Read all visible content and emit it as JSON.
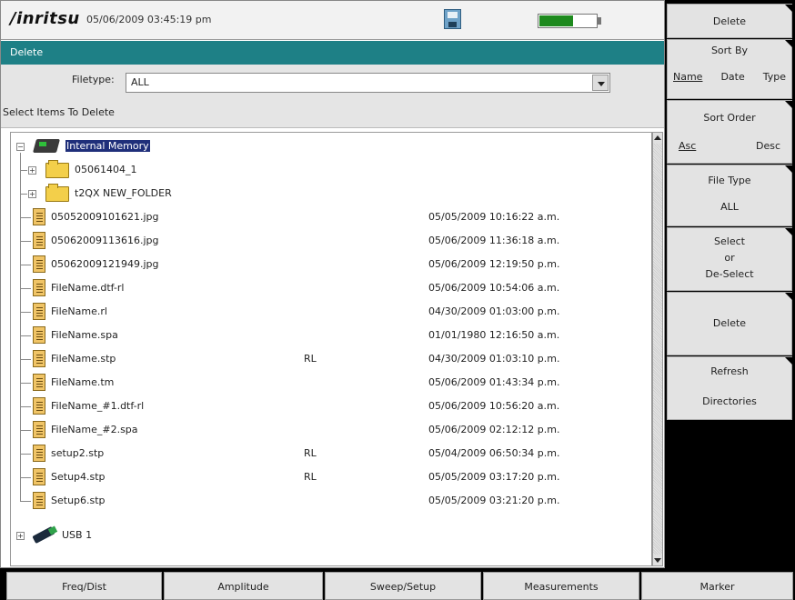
{
  "header": {
    "logo": "/inritsu",
    "datetime": "05/06/2009 03:45:19 pm",
    "battery_level": 0.6
  },
  "panel": {
    "title": "Delete",
    "filetype_label": "Filetype:",
    "filetype_value": "ALL",
    "select_items_label": "Select Items To Delete"
  },
  "tree": {
    "root": "Internal Memory",
    "folders": [
      "05061404_1",
      "t2QX NEW_FOLDER"
    ],
    "files": [
      {
        "name": "05052009101621.jpg",
        "type": "",
        "date": "05/05/2009 10:16:22 a.m."
      },
      {
        "name": "05062009113616.jpg",
        "type": "",
        "date": "05/06/2009 11:36:18 a.m."
      },
      {
        "name": "05062009121949.jpg",
        "type": "",
        "date": "05/06/2009 12:19:50 p.m."
      },
      {
        "name": "FileName.dtf-rl",
        "type": "",
        "date": "05/06/2009 10:54:06 a.m."
      },
      {
        "name": "FileName.rl",
        "type": "",
        "date": "04/30/2009 01:03:00 p.m."
      },
      {
        "name": "FileName.spa",
        "type": "",
        "date": "01/01/1980 12:16:50 a.m."
      },
      {
        "name": "FileName.stp",
        "type": "RL",
        "date": "04/30/2009 01:03:10 p.m."
      },
      {
        "name": "FileName.tm",
        "type": "",
        "date": "05/06/2009 01:43:34 p.m."
      },
      {
        "name": "FileName_#1.dtf-rl",
        "type": "",
        "date": "05/06/2009 10:56:20 a.m."
      },
      {
        "name": "FileName_#2.spa",
        "type": "",
        "date": "05/06/2009 02:12:12 p.m."
      },
      {
        "name": "setup2.stp",
        "type": "RL",
        "date": "05/04/2009 06:50:34 p.m."
      },
      {
        "name": "Setup4.stp",
        "type": "RL",
        "date": "05/05/2009 03:17:20 p.m."
      },
      {
        "name": "Setup6.stp",
        "type": "",
        "date": "05/05/2009 03:21:20 p.m."
      }
    ],
    "usb": "USB 1"
  },
  "softkeys": {
    "delete_title": "Delete",
    "sort_by": {
      "title": "Sort By",
      "opt1": "Name",
      "opt2": "Date",
      "opt3": "Type"
    },
    "sort_order": {
      "title": "Sort Order",
      "opt1": "Asc",
      "opt2": "Desc"
    },
    "file_type": {
      "title": "File Type",
      "value": "ALL"
    },
    "select": {
      "line1": "Select",
      "line2": "or",
      "line3": "De-Select"
    },
    "delete": "Delete",
    "refresh": {
      "line1": "Refresh",
      "line2": "Directories"
    }
  },
  "bottom": [
    "Freq/Dist",
    "Amplitude",
    "Sweep/Setup",
    "Measurements",
    "Marker"
  ]
}
